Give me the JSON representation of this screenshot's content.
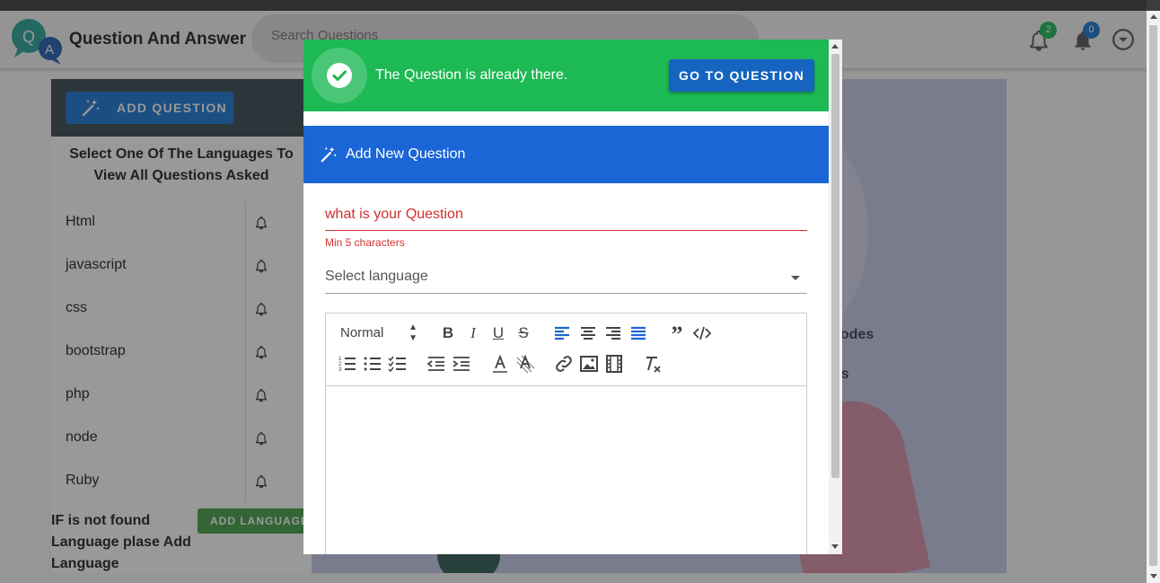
{
  "app": {
    "brand": "Question And Answer",
    "logo_letters": [
      "Q",
      "A"
    ],
    "search_placeholder": "Search Questions"
  },
  "notifications": [
    {
      "icon": "bell-icon",
      "count": "2",
      "color": "#1cb954"
    },
    {
      "icon": "bell-icon",
      "count": "0",
      "color": "#1976d2"
    }
  ],
  "sidebar": {
    "add_question_label": "ADD QUESTION",
    "select_title": "Select One Of The Languages To View All Questions Asked",
    "languages": [
      {
        "label": "Html"
      },
      {
        "label": "javascript"
      },
      {
        "label": "css"
      },
      {
        "label": "bootstrap"
      },
      {
        "label": "php"
      },
      {
        "label": "node"
      },
      {
        "label": "Ruby"
      }
    ],
    "not_found_text": "IF is not found Language plase Add Language",
    "add_language_label": "ADD LANGUAGE"
  },
  "background_panel": {
    "text1": "codes",
    "text2": "ns"
  },
  "dialog": {
    "alert_message": "The Question is already there.",
    "goto_button_label": "GO TO QUESTION",
    "header_title": "Add New Question",
    "question_placeholder": "what is your Question",
    "question_error": "Min 5 characters",
    "language_placeholder": "Select language",
    "editor": {
      "format_value": "Normal",
      "tools_row1": [
        "bold-icon",
        "italic-icon",
        "underline-icon",
        "strike-icon",
        "align-left-icon",
        "align-center-icon",
        "align-right-icon",
        "align-justify-icon",
        "blockquote-icon",
        "code-icon"
      ],
      "tools_row2": [
        "ordered-list-icon",
        "bullet-list-icon",
        "check-list-icon",
        "outdent-icon",
        "indent-icon",
        "text-color-icon",
        "background-color-icon",
        "link-icon",
        "image-icon",
        "video-icon",
        "clear-format-icon"
      ],
      "active_color": "#1a66d6"
    }
  },
  "colors": {
    "success": "#1cb954",
    "primary": "#1a66d6",
    "error": "#d32f2f",
    "add_language": "#43a047"
  }
}
